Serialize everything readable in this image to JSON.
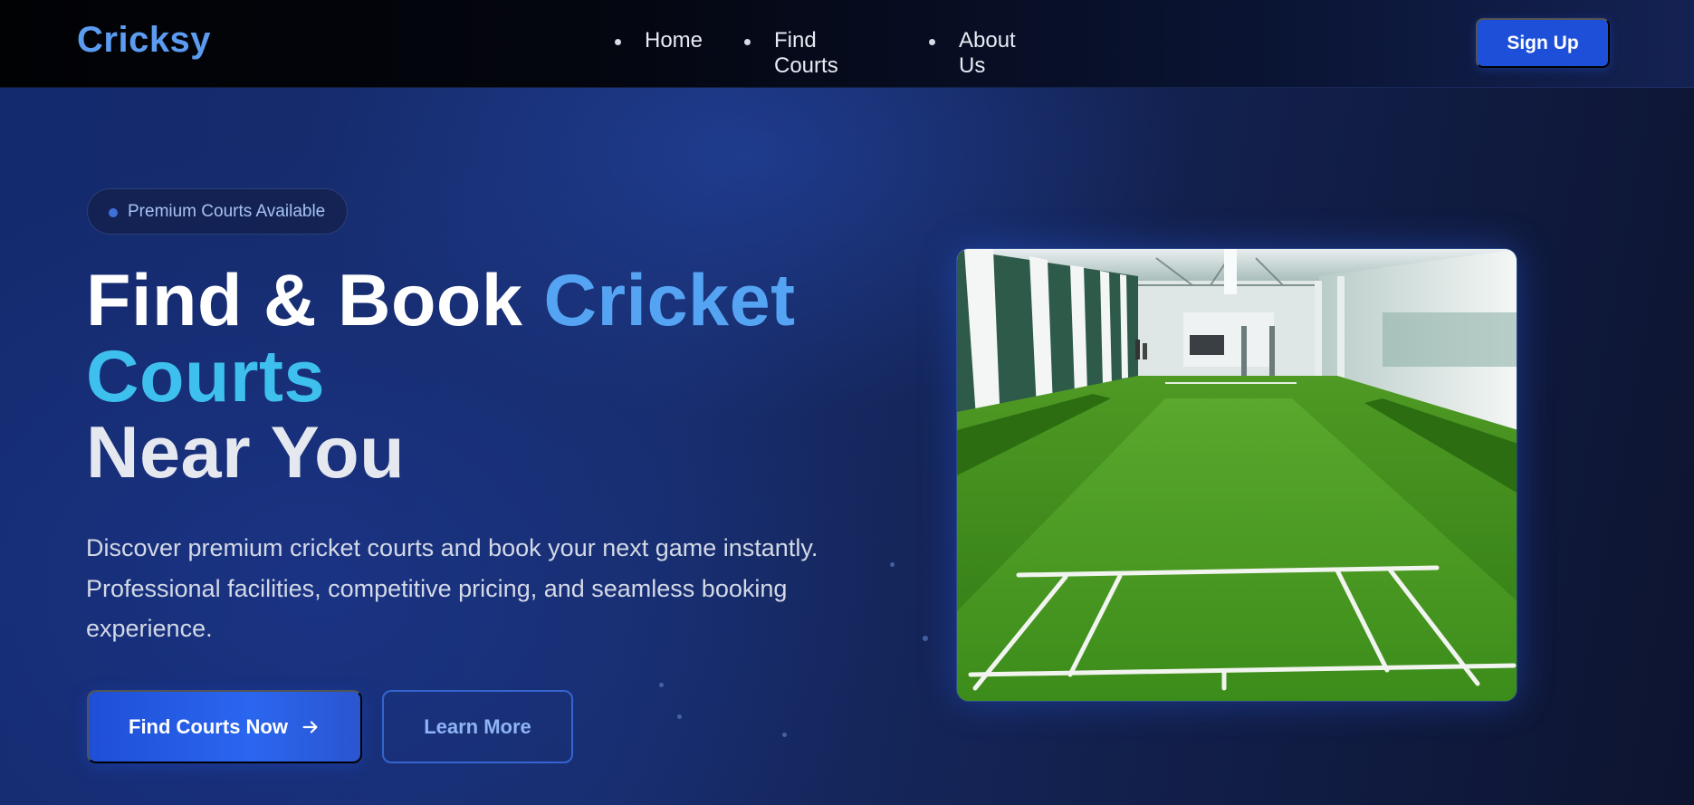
{
  "navbar": {
    "logo": "Cricksy",
    "links": [
      {
        "label": "Home"
      },
      {
        "label": "Find Courts"
      },
      {
        "label": "About Us"
      }
    ],
    "signup_label": "Sign Up"
  },
  "hero": {
    "badge_text": "Premium Courts Available",
    "headline": {
      "part1": "Find & Book ",
      "accent1": "Cricket",
      "accent2": "Courts",
      "part3": "Near You"
    },
    "subtext": "Discover premium cricket courts and book your next game instantly. Professional facilities, competitive pricing, and seamless booking experience.",
    "primary_cta": "Find Courts Now",
    "primary_cta_icon": "arrow-right-icon",
    "secondary_cta": "Learn More"
  },
  "colors": {
    "brand": "#5b9cf0",
    "primary_button": "#1e4fd8",
    "headline_accent": "#55a4f3",
    "headline_accent2": "#3ec0ee"
  }
}
